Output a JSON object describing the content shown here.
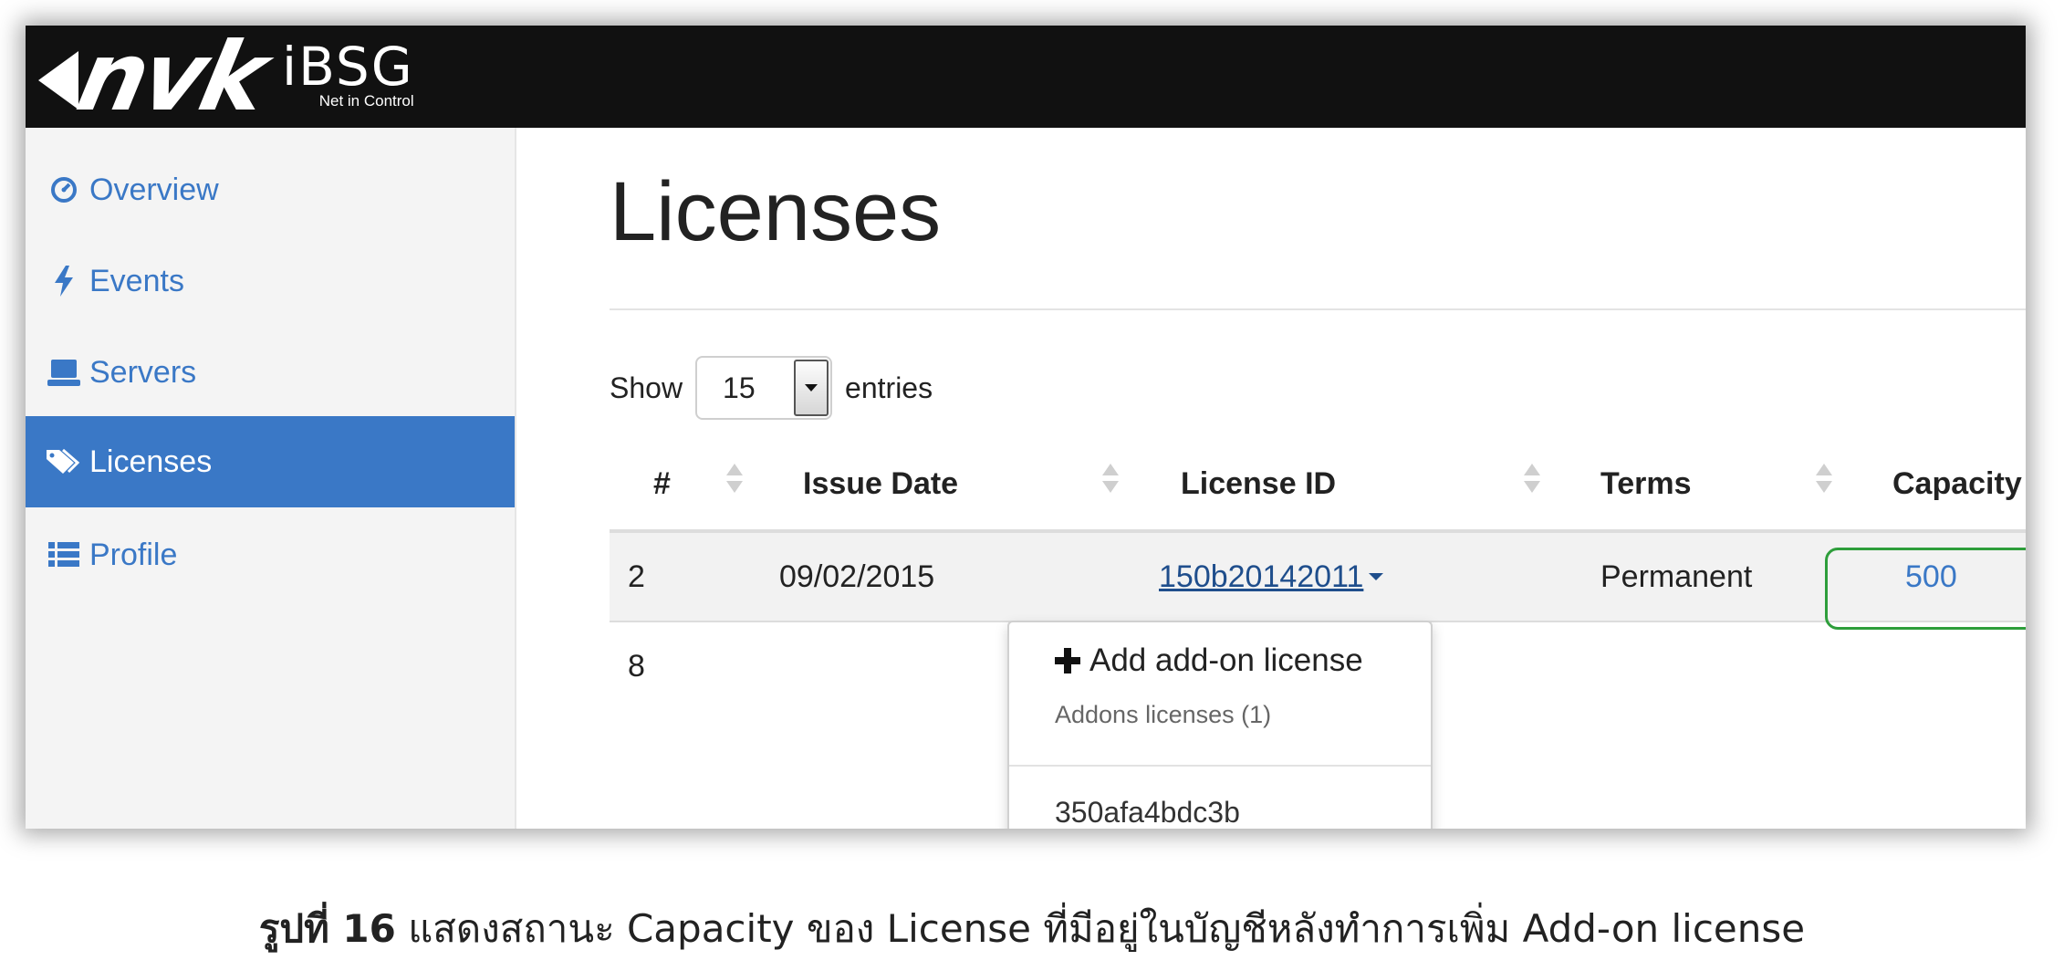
{
  "brand": {
    "logo_text": "nvk",
    "product": "iBSG",
    "tagline": "Net in Control"
  },
  "sidebar": {
    "items": [
      {
        "label": "Overview",
        "icon": "dashboard-icon",
        "active": false
      },
      {
        "label": "Events",
        "icon": "bolt-icon",
        "active": false
      },
      {
        "label": "Servers",
        "icon": "server-icon",
        "active": false
      },
      {
        "label": "Licenses",
        "icon": "tags-icon",
        "active": true
      },
      {
        "label": "Profile",
        "icon": "list-icon",
        "active": false
      }
    ]
  },
  "main": {
    "title": "Licenses",
    "show_label": "Show",
    "entries_label": "entries",
    "page_size": "15"
  },
  "table": {
    "columns": [
      "#",
      "Issue Date",
      "License ID",
      "Terms",
      "Capacity"
    ],
    "rows": [
      {
        "num": "2",
        "issue_date": "09/02/2015",
        "license_id": "150b20142011",
        "terms": "Permanent",
        "capacity": "500"
      },
      {
        "num": "8",
        "issue_date": "",
        "license_id": "",
        "terms": "",
        "capacity": ""
      }
    ]
  },
  "dropdown": {
    "add_label": "Add add-on license",
    "header": "Addons licenses (1)",
    "items": [
      "350afa4bdc3b"
    ]
  },
  "caption": {
    "fig_label": "รูปที่ 16",
    "text": "แสดงสถานะ Capacity ของ License ที่มีอยู่ในบัญชีหลังทำการเพิ่ม Add-on license"
  },
  "colors": {
    "accent": "#3a78c6",
    "topbar": "#111111",
    "highlight": "#2e9e3b"
  }
}
